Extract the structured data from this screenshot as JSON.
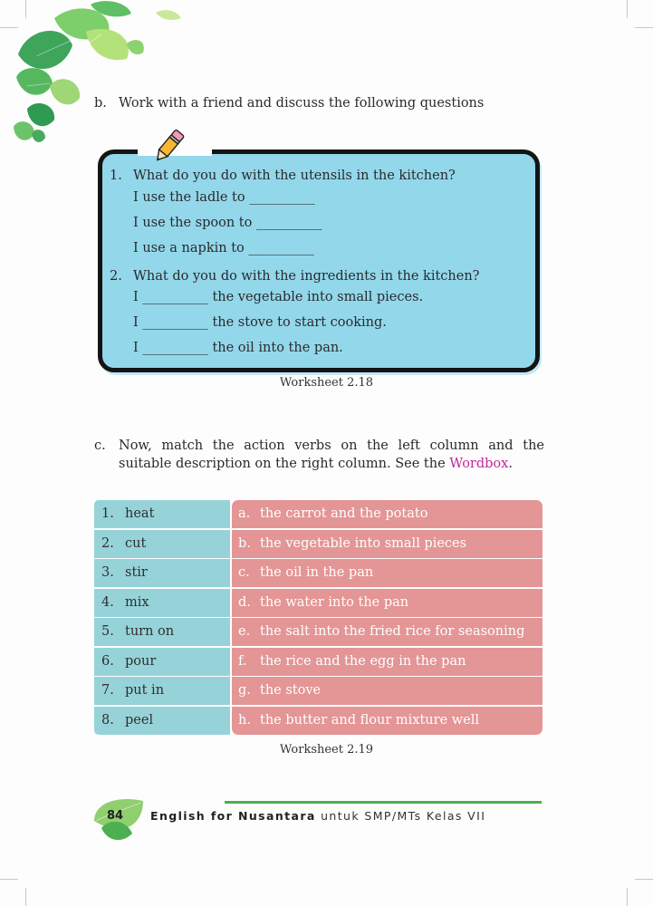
{
  "section_b": {
    "marker": "b.",
    "text": "Work with a friend and discuss the following questions"
  },
  "worksheet_218": {
    "q1": {
      "num": "1.",
      "text": "What do you do with the utensils in the kitchen?",
      "lines": [
        "I use the ladle to __________",
        "I use the spoon to __________",
        "I use a napkin to __________"
      ]
    },
    "q2": {
      "num": "2.",
      "text": "What do you do with the ingredients in the kitchen?",
      "lines": [
        "I __________ the vegetable into small pieces.",
        "I __________ the stove to start cooking.",
        "I __________ the oil into the pan."
      ]
    },
    "caption": "Worksheet 2.18"
  },
  "section_c": {
    "marker": "c.",
    "text": "Now, match the action verbs on the left column and the suitable description on the right column. See the",
    "wordbox": "Wordbox",
    "period": "."
  },
  "worksheet_219": {
    "left": [
      {
        "num": "1.",
        "word": "heat"
      },
      {
        "num": "2.",
        "word": "cut"
      },
      {
        "num": "3.",
        "word": "stir"
      },
      {
        "num": "4.",
        "word": "mix"
      },
      {
        "num": "5.",
        "word": "turn on"
      },
      {
        "num": "6.",
        "word": "pour"
      },
      {
        "num": "7.",
        "word": "put in"
      },
      {
        "num": "8.",
        "word": "peel"
      }
    ],
    "right": [
      {
        "letter": "a.",
        "text": "the carrot and the potato"
      },
      {
        "letter": "b.",
        "text": "the vegetable into small pieces"
      },
      {
        "letter": "c.",
        "text": "the oil in the pan"
      },
      {
        "letter": "d.",
        "text": "the water into the pan"
      },
      {
        "letter": "e.",
        "text": "the salt into the fried rice for seasoning"
      },
      {
        "letter": "f.",
        "text": "the rice and the egg in the pan"
      },
      {
        "letter": "g.",
        "text": "the stove"
      },
      {
        "letter": "h.",
        "text": "the butter and flour mixture well"
      }
    ],
    "caption": "Worksheet 2.19"
  },
  "footer": {
    "page_number": "84",
    "book_title": "English for Nusantara",
    "subtitle": "untuk SMP/MTs Kelas VII"
  },
  "colors": {
    "box_blue": "#93d7eb",
    "left_col": "#96d3d9",
    "right_col": "#e49595",
    "wordbox": "#c2289a",
    "footer_line": "#4caf50"
  }
}
